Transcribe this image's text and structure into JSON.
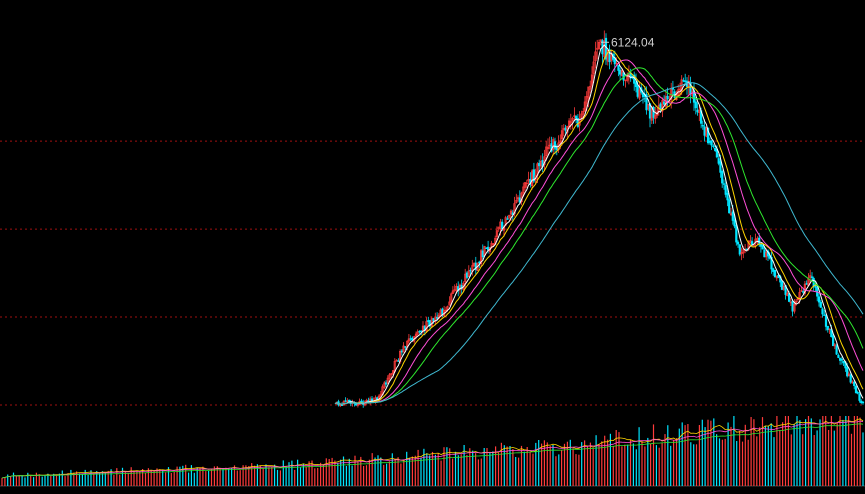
{
  "chart_data": {
    "type": "line",
    "subtype": "candlestick-with-moving-averages",
    "title": "",
    "xlabel": "",
    "ylabel": "",
    "peak_label": "6124.04",
    "ylim": [
      2000,
      6400
    ],
    "grid": {
      "horizontal": true,
      "style": "dotted",
      "color": "#a01010",
      "levels": [
        2000,
        3000,
        4000,
        5000
      ]
    },
    "colors": {
      "background": "#000000",
      "up_candle": "#ff3b3b",
      "down_candle": "#00e5ff",
      "ma_short": "#ffffff",
      "ma_mid": "#ffd700",
      "ma_long": "#ff4fd8",
      "ma_longer": "#2ee82e",
      "ma_longest": "#3fb8d0",
      "volume_baseline": "#404040"
    },
    "anchors": {
      "x": [
        0,
        24,
        40,
        60,
        80,
        100,
        120,
        140,
        150,
        160,
        180,
        200,
        220,
        230,
        240,
        260,
        270,
        285,
        300
      ],
      "close": [
        2000,
        2050,
        2700,
        3050,
        3600,
        4200,
        4850,
        5300,
        6124.04,
        5900,
        5300,
        5700,
        4600,
        3700,
        3900,
        3100,
        3450,
        2600,
        2000
      ]
    },
    "series": [
      {
        "name": "",
        "kind": "candles"
      },
      {
        "name": "",
        "kind": "ma",
        "period": 5
      },
      {
        "name": "",
        "kind": "ma",
        "period": 10
      },
      {
        "name": "",
        "kind": "ma",
        "period": 20
      },
      {
        "name": "",
        "kind": "ma",
        "period": 30
      },
      {
        "name": "",
        "kind": "ma",
        "period": 60
      }
    ],
    "volume_panel": {
      "present": true,
      "trend_x": [
        0,
        100,
        190,
        250,
        300
      ],
      "trend_level": [
        0.15,
        0.3,
        0.55,
        0.8,
        1.0
      ]
    }
  }
}
